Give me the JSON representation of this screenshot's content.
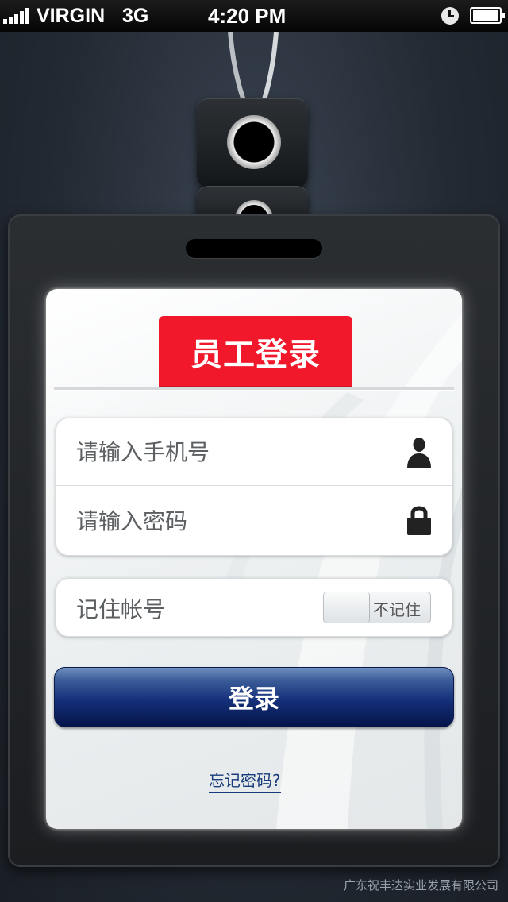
{
  "status_bar": {
    "carrier": "VIRGIN",
    "network": "3G",
    "time": "4:20 PM"
  },
  "login": {
    "title": "员工登录",
    "phone_placeholder": "请输入手机号",
    "password_placeholder": "请输入密码",
    "remember_label": "记住帐号",
    "remember_toggle_text": "不记住",
    "remember_enabled": false,
    "submit_label": "登录",
    "forgot_password": "忘记密码?"
  },
  "footer": {
    "company": "广东祝丰达实业发展有限公司"
  },
  "colors": {
    "title_red": "#f0182a",
    "button_navy": "#15307a",
    "link_blue": "#173a7a"
  }
}
